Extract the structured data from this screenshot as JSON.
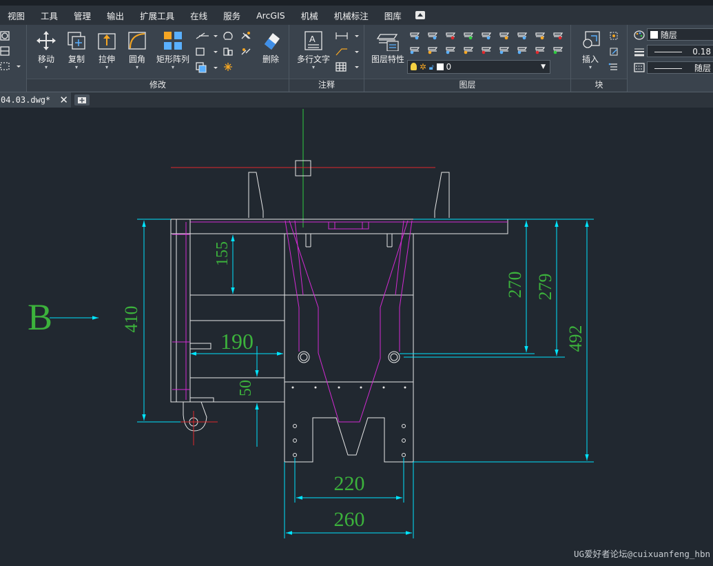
{
  "menu": {
    "items": [
      "视图",
      "工具",
      "管理",
      "输出",
      "扩展工具",
      "在线",
      "服务",
      "ArcGIS",
      "机械",
      "机械标注",
      "图库"
    ]
  },
  "ribbon": {
    "modify": {
      "title": "修改",
      "move": "移动",
      "copy": "复制",
      "stretch": "拉伸",
      "fillet": "圆角",
      "array": "矩形阵列",
      "erase": "删除"
    },
    "annotation": {
      "title": "注释",
      "mtext": "多行文字"
    },
    "layers": {
      "title": "图层",
      "properties": "图层特性",
      "current_layer": "0"
    },
    "block": {
      "title": "块",
      "insert": "插入"
    },
    "properties": {
      "color": "随层",
      "lineweight": "0.18",
      "linetype": "随层"
    }
  },
  "tabs": {
    "document": "04.03.dwg*"
  },
  "drawing": {
    "view_label": "B",
    "dimensions": [
      "155",
      "190",
      "50",
      "410",
      "270",
      "279",
      "492",
      "220",
      "260"
    ]
  },
  "watermark": "UG爱好者论坛@cuixuanfeng_hbn",
  "colors": {
    "background": "#212830",
    "ribbon": "#3a434d",
    "dimension_text": "#3cb23c",
    "dimension_line": "#00e5ff",
    "geometry": "#e8e8e8",
    "hidden": "#d42ad4",
    "center_red": "#e0282c",
    "center_green": "#2ecc40",
    "accent_orange": "#f5a623"
  }
}
